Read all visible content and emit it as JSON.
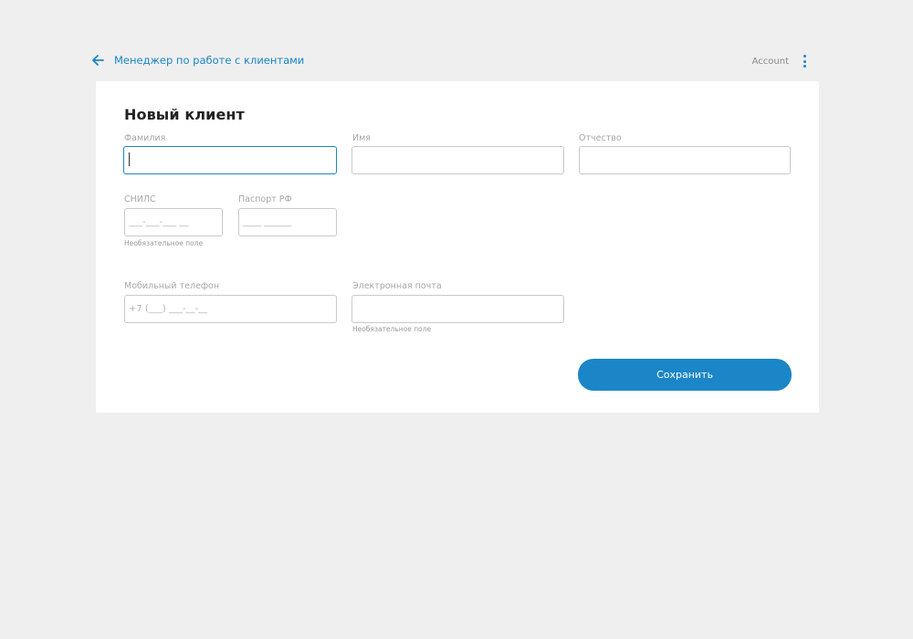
{
  "header": {
    "back_label": "Менеджер по работе с клиентами",
    "account_label": "Account"
  },
  "form": {
    "title": "Новый клиент",
    "fields": {
      "last_name": {
        "label": "Фамилия",
        "value": ""
      },
      "first_name": {
        "label": "Имя",
        "value": ""
      },
      "patronymic": {
        "label": "Отчество",
        "value": ""
      },
      "snils": {
        "label": "СНИЛС",
        "placeholder": "___-___-___ __",
        "hint": "Необязательное поле"
      },
      "passport": {
        "label": "Паспорт РФ",
        "placeholder": "____ ______"
      },
      "phone": {
        "label": "Мобильный телефон",
        "placeholder": "+7 (___) ___-__-__"
      },
      "email": {
        "label": "Электронная почта",
        "value": "",
        "hint": "Необязательное поле"
      }
    },
    "save_label": "Сохранить"
  },
  "colors": {
    "accent": "#1a86c7",
    "background": "#efefef",
    "card": "#ffffff"
  },
  "icons": {
    "back": "arrow-left-icon",
    "menu": "more-vertical-icon"
  }
}
